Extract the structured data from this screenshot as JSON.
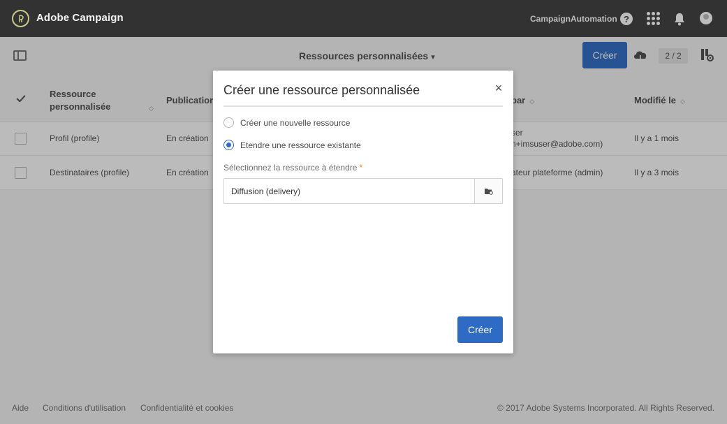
{
  "header": {
    "app_title": "Adobe Campaign",
    "user_name": "CampaignAutomation",
    "help_glyph": "?"
  },
  "toolbar": {
    "page_title": "Ressources personnalisées",
    "create_label": "Créer",
    "pager": "2 / 2"
  },
  "table": {
    "columns": [
      {
        "label": "Ressource personnalisée"
      },
      {
        "label": "Publication"
      },
      {
        "label": "par"
      },
      {
        "label": "Modifié le"
      }
    ],
    "rows": [
      {
        "name": "Profil (profile)",
        "publication": "En création",
        "by_line1": "ser",
        "by_line2": "n+imsuser@adobe.com)",
        "modified": "Il y a 1 mois"
      },
      {
        "name": "Destinataires (profile)",
        "publication": "En création",
        "by_line1": "ateur plateforme (admin)",
        "by_line2": "",
        "modified": "Il y a 3 mois"
      }
    ]
  },
  "modal": {
    "title": "Créer une ressource personnalisée",
    "close_glyph": "×",
    "radio_new": "Créer une nouvelle ressource",
    "radio_extend": "Etendre une ressource existante",
    "selected_option": "extend",
    "field_label": "Sélectionnez la ressource à étendre",
    "required_mark": "*",
    "field_value": "Diffusion (delivery)",
    "create_label": "Créer"
  },
  "footer": {
    "help": "Aide",
    "terms": "Conditions d'utilisation",
    "privacy": "Confidentialité et cookies",
    "copyright": "© 2017 Adobe Systems Incorporated. All Rights Reserved."
  },
  "colors": {
    "accent": "#2d6bc4",
    "header_bg": "#323232",
    "required": "#e68619"
  },
  "icons": {
    "logo": "adobe-campaign-logo-icon",
    "help": "help-icon",
    "apps": "apps-grid-icon",
    "notifications": "bell-icon",
    "avatar": "avatar",
    "panel": "panel-toggle-icon",
    "cloud": "cloud-upload-icon",
    "config": "column-config-icon",
    "field_picker": "folder-picker-icon"
  }
}
